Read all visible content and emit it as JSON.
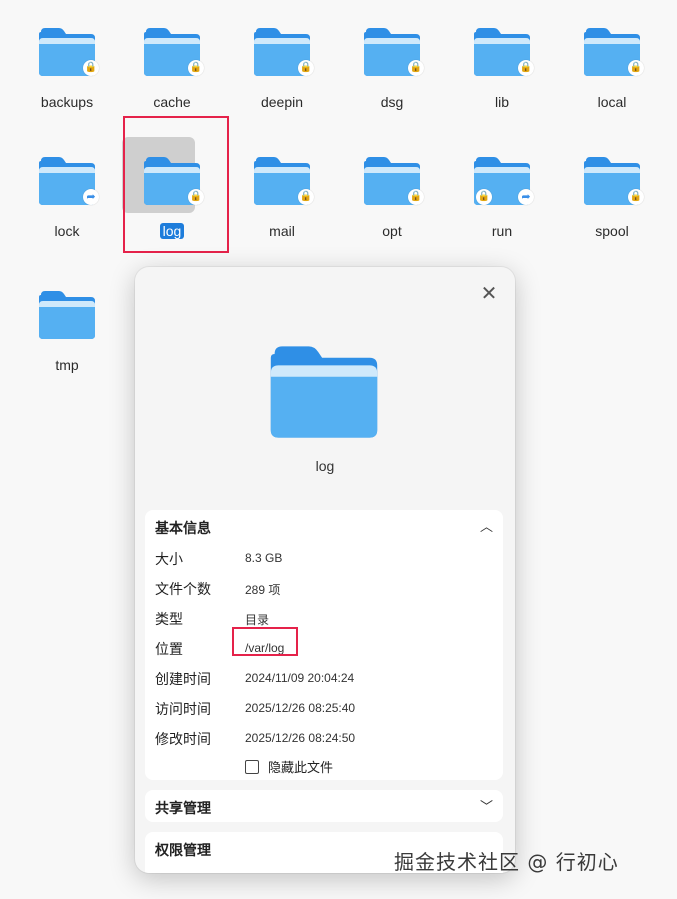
{
  "folders": [
    {
      "name": "backups",
      "badge": "lock"
    },
    {
      "name": "cache",
      "badge": "lock"
    },
    {
      "name": "deepin",
      "badge": "lock"
    },
    {
      "name": "dsg",
      "badge": "lock"
    },
    {
      "name": "lib",
      "badge": "lock"
    },
    {
      "name": "local",
      "badge": "lock"
    },
    {
      "name": "lock",
      "badge": "link"
    },
    {
      "name": "log",
      "badge": "lock",
      "selected": true
    },
    {
      "name": "mail",
      "badge": "lock"
    },
    {
      "name": "opt",
      "badge": "lock"
    },
    {
      "name": "run",
      "badge": "lock-link"
    },
    {
      "name": "spool",
      "badge": "lock"
    },
    {
      "name": "tmp",
      "badge": ""
    }
  ],
  "dialog": {
    "name": "log",
    "basic_info": {
      "title": "基本信息",
      "rows": [
        {
          "label": "大小",
          "value": "8.3 GB"
        },
        {
          "label": "文件个数",
          "value": "289 项"
        },
        {
          "label": "类型",
          "value": "目录"
        },
        {
          "label": "位置",
          "value": "/var/log"
        },
        {
          "label": "创建时间",
          "value": "2024/11/09 20:04:24"
        },
        {
          "label": "访问时间",
          "value": "2025/12/26 08:25:40"
        },
        {
          "label": "修改时间",
          "value": "2025/12/26 08:24:50"
        }
      ],
      "hide_checkbox_label": "隐藏此文件"
    },
    "share_title": "共享管理",
    "permission_title": "权限管理"
  },
  "watermark": "掘金技术社区 @ 行初心",
  "colors": {
    "folder_blue": "#2f8fe6",
    "folder_light": "#5fb8f4",
    "highlight": "#e5224a",
    "selected_label": "#1e7ddb"
  }
}
